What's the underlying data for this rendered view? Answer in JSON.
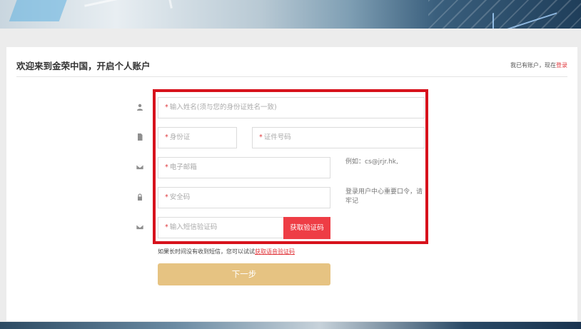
{
  "header": {
    "title": "欢迎来到金荣中国，开启个人账户",
    "login_hint": "我已有账户，现在",
    "login_link": "登录"
  },
  "form": {
    "name_placeholder": "输入姓名(须与您的身份证姓名一致)",
    "id_type_placeholder": "身份证",
    "id_number_placeholder": "证件号码",
    "email_placeholder": "电子邮箱",
    "email_hint": "例如：cs@jrjr.hk,",
    "security_code_placeholder": "安全码",
    "security_hint": "登录用户中心重要口令，请牢记",
    "sms_code_placeholder": "输入短信验证码",
    "sms_button": "获取验证码",
    "required_mark": "*"
  },
  "footer_note": {
    "text": "如果长时间没有收到短信，您可以试试",
    "voice_link": "获取语音验证码"
  },
  "next_button": "下一步",
  "colors": {
    "accent_red": "#ee3d45",
    "next_button": "#e6c382",
    "highlight_border": "#d7121c"
  },
  "icons": {
    "name_row": "user-icon",
    "id_row": "document-icon",
    "email_row": "envelope-icon",
    "security_row": "lock-icon",
    "sms_row": "envelope-icon"
  }
}
